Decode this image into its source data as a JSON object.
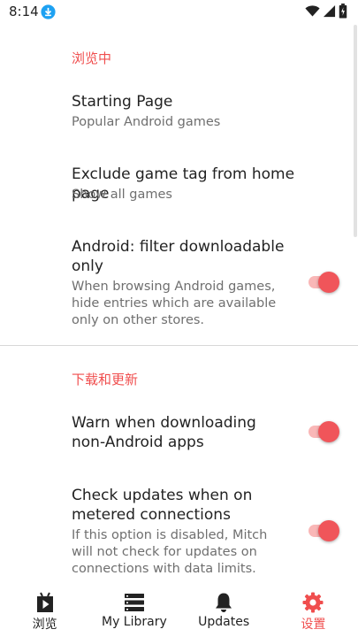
{
  "status_bar": {
    "time": "8:14",
    "icons": [
      "download-icon",
      "wifi-icon",
      "signal-icon",
      "battery-icon"
    ]
  },
  "colors": {
    "accent": "#f04e4e",
    "switch_thumb": "#f0555a",
    "switch_track": "#f9b7b7"
  },
  "sections": {
    "browse": {
      "title": "浏览中",
      "starting_page": {
        "title": "Starting Page",
        "summary": "Popular Android games"
      },
      "exclude_tag": {
        "title": "Exclude game tag from home page",
        "summary": "Show all games"
      },
      "android_filter": {
        "title": "Android: filter downloadable only",
        "summary": "When browsing Android games, hide entries which are available only on other stores.",
        "enabled": true
      }
    },
    "downloads": {
      "title": "下载和更新",
      "warn_non_android": {
        "title": "Warn when downloading non-Android apps",
        "enabled": true
      },
      "metered_updates": {
        "title": "Check updates when on metered connections",
        "summary": "If this option is disabled, Mitch will not check for updates on connections with data limits.",
        "enabled": true
      }
    }
  },
  "bottom_nav": {
    "items": [
      {
        "label": "浏览",
        "icon": "play-store-icon",
        "active": false
      },
      {
        "label": "My Library",
        "icon": "library-icon",
        "active": false
      },
      {
        "label": "Updates",
        "icon": "bell-icon",
        "active": false
      },
      {
        "label": "设置",
        "icon": "gear-icon",
        "active": true
      }
    ]
  }
}
